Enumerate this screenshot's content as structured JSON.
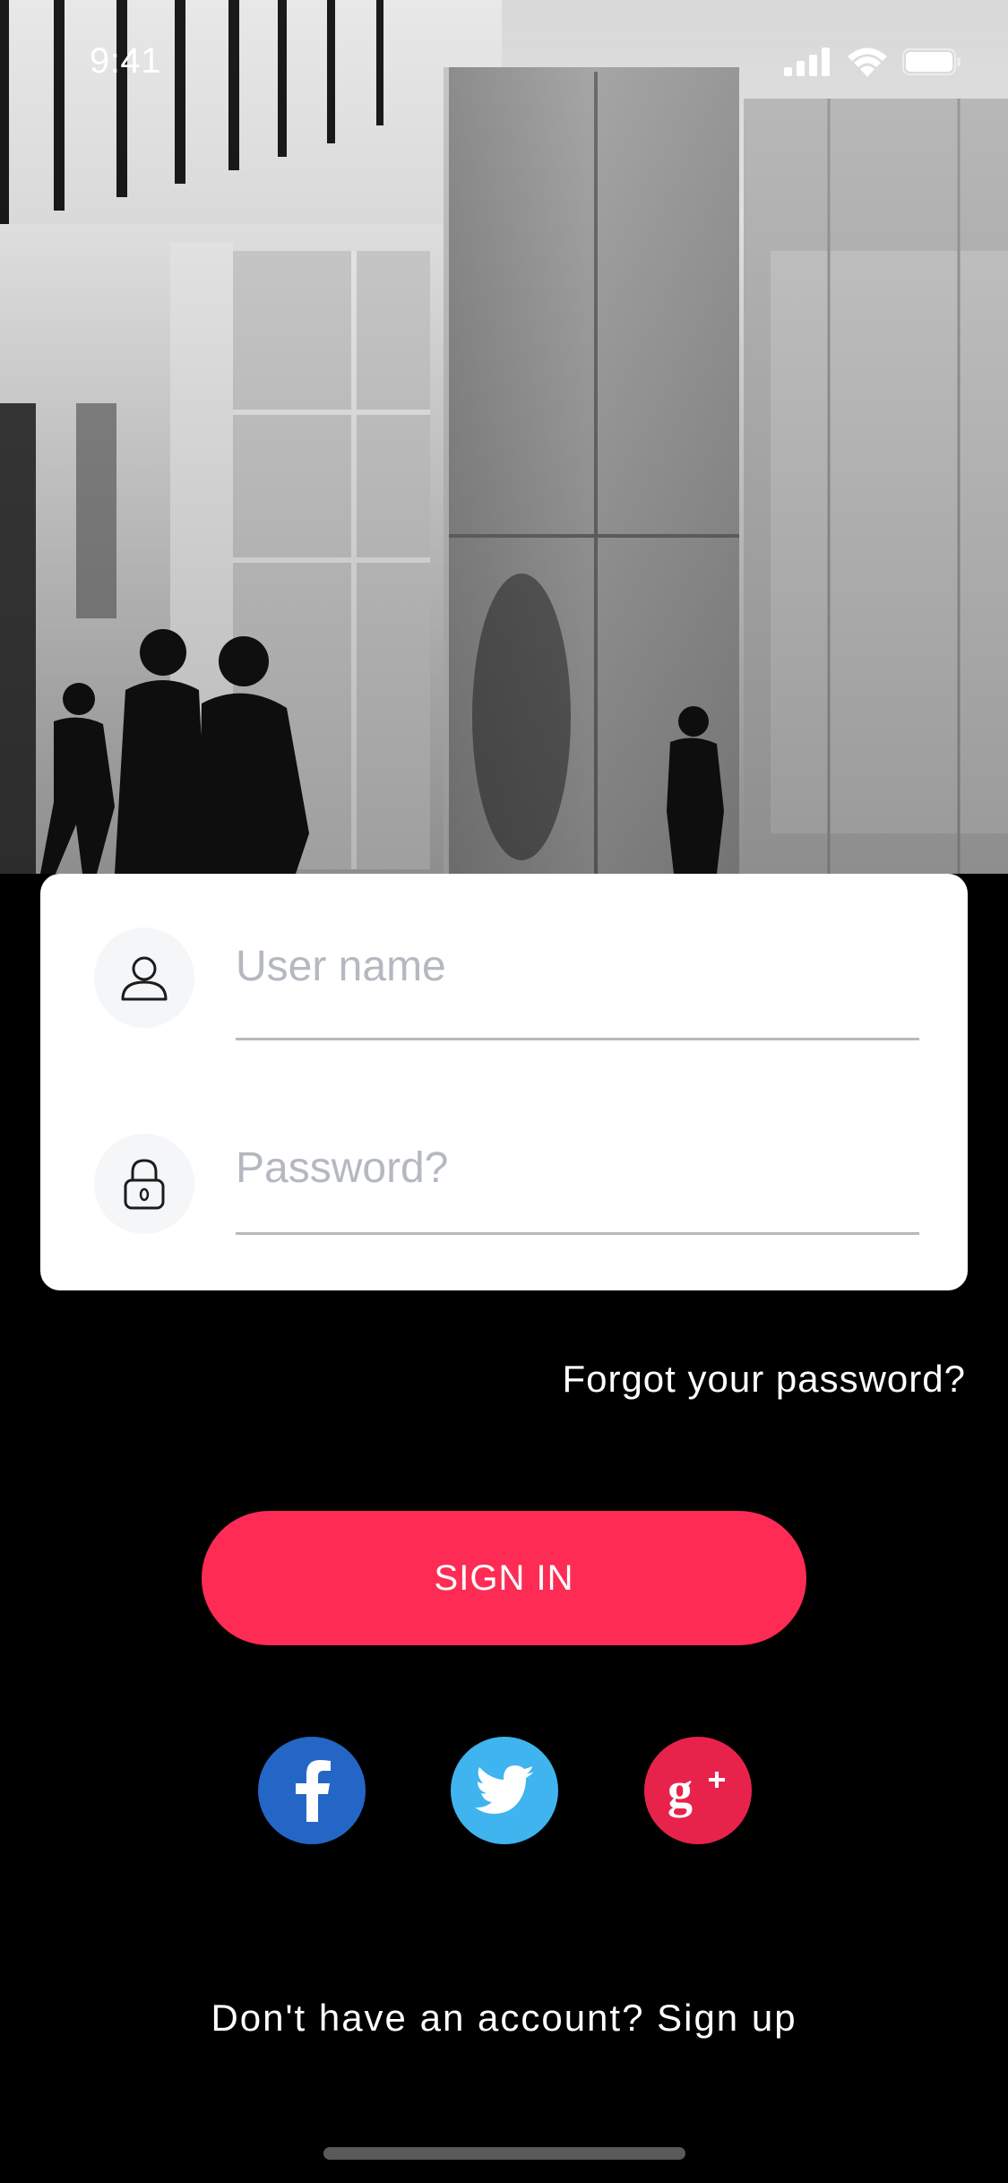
{
  "status_bar": {
    "time": "9:41",
    "icons": [
      "cellular-signal-icon",
      "wifi-icon",
      "battery-icon"
    ]
  },
  "hero": {
    "description_icon": "office-lobby-photo"
  },
  "login_form": {
    "username": {
      "placeholder": "User name",
      "value": "",
      "icon": "user-icon"
    },
    "password": {
      "placeholder": "Password?",
      "value": "",
      "icon": "lock-icon"
    }
  },
  "forgot_password": "Forgot your password?",
  "sign_in_label": "SIGN IN",
  "social": [
    {
      "name": "facebook",
      "icon": "facebook-icon",
      "color": "#2466c6"
    },
    {
      "name": "twitter",
      "icon": "twitter-icon",
      "color": "#3fb4ee"
    },
    {
      "name": "google-plus",
      "icon": "google-plus-icon",
      "color": "#e7234c"
    }
  ],
  "signup_prompt": "Don't have an account? Sign up",
  "colors": {
    "accent": "#fe2c54",
    "background": "#000000",
    "card": "#ffffff"
  }
}
